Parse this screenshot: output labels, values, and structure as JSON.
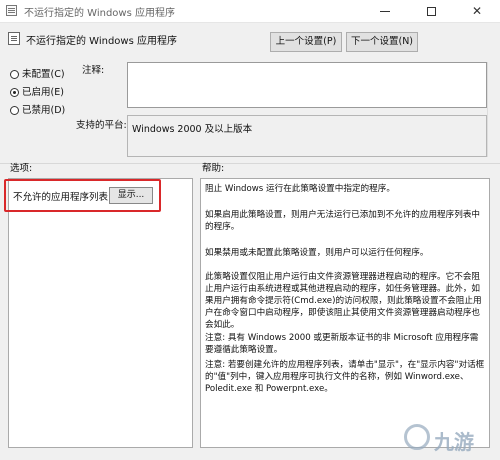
{
  "window": {
    "title": "不运行指定的 Windows 应用程序",
    "controls": {
      "minimize": "—",
      "maximize": "□",
      "close": "✕"
    }
  },
  "header": {
    "policy_title": "不运行指定的 Windows 应用程序",
    "prev_label": "上一个设置(P)",
    "next_label": "下一个设置(N)"
  },
  "state": {
    "options": [
      {
        "label": "未配置(C)",
        "selected": false
      },
      {
        "label": "已启用(E)",
        "selected": true
      },
      {
        "label": "已禁用(D)",
        "selected": false
      }
    ],
    "comment_label": "注释:",
    "comment_value": "",
    "platform_label": "支持的平台:",
    "platform_value": "Windows 2000 及以上版本"
  },
  "options_section": {
    "title": "选项:",
    "item_label": "不允许的应用程序列表",
    "show_button": "显示..."
  },
  "help_section": {
    "title": "帮助:",
    "paragraphs": [
      "阻止 Windows 运行在此策略设置中指定的程序。",
      "如果启用此策略设置，则用户无法运行已添加到不允许的应用程序列表中的程序。",
      "如果禁用或未配置此策略设置，则用户可以运行任何程序。",
      "此策略设置仅阻止用户运行由文件资源管理器进程启动的程序。它不会阻止用户运行由系统进程或其他进程启动的程序，如任务管理器。此外，如果用户拥有命令提示符(Cmd.exe)的访问权限，则此策略设置不会阻止用户在命令窗口中启动程序，即使该阻止其使用文件资源管理器启动程序也会如此。",
      "注意: 具有 Windows 2000 或更新版本证书的非 Microsoft 应用程序需要遵循此策略设置。",
      "注意: 若要创建允许的应用程序列表，请单击\"显示\"，在\"显示内容\"对话框的\"值\"列中，键入应用程序可执行文件的名称，例如 Winword.exe、Poledit.exe 和 Powerpnt.exe。"
    ]
  },
  "colors": {
    "highlight": "#d9282a",
    "window_bg": "#f0f0f0"
  },
  "watermark": {
    "text": "九游"
  }
}
